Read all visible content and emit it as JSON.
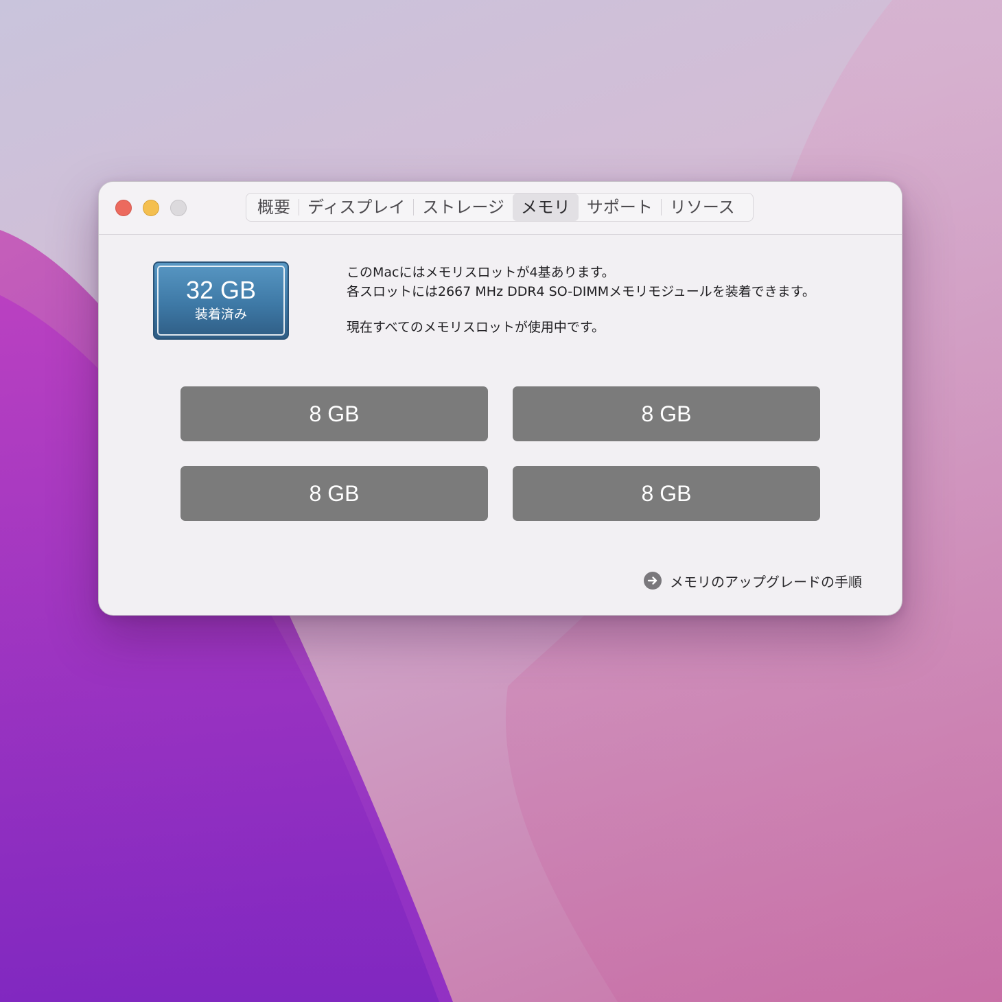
{
  "window": {
    "tabs": [
      {
        "label": "概要",
        "active": false
      },
      {
        "label": "ディスプレイ",
        "active": false
      },
      {
        "label": "ストレージ",
        "active": false
      },
      {
        "label": "メモリ",
        "active": true
      },
      {
        "label": "サポート",
        "active": false
      },
      {
        "label": "リソース",
        "active": false
      }
    ]
  },
  "memory": {
    "badge": {
      "size": "32 GB",
      "status": "装着済み"
    },
    "info_lines": [
      "このMacにはメモリスロットが4基あります。",
      "各スロットには2667 MHz DDR4 SO-DIMMメモリモジュールを装着できます。",
      "現在すべてのメモリスロットが使用中です。"
    ],
    "slots": [
      "8 GB",
      "8 GB",
      "8 GB",
      "8 GB"
    ],
    "upgrade_link": "メモリのアップグレードの手順"
  },
  "colors": {
    "badge_blue": "#3e79a6",
    "slot_gray": "#7b7b7b",
    "close": "#ec6a5e",
    "minimize": "#f4bf4f",
    "zoom_disabled": "#dcdadd"
  },
  "icons": {
    "upgrade_link_icon": "arrow-right-circle-icon"
  }
}
